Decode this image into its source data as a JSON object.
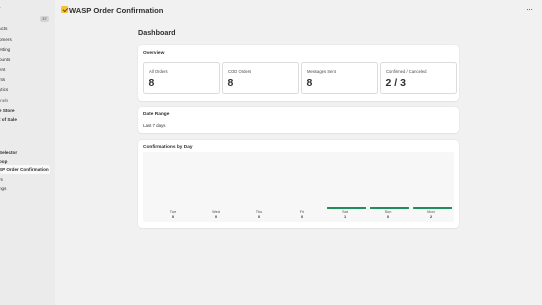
{
  "sidebar": {
    "items": [
      {
        "label": "r",
        "badge": ""
      },
      {
        "label": "",
        "badge": "37"
      },
      {
        "label": "ucts",
        "badge": ""
      },
      {
        "label": "omers",
        "badge": ""
      },
      {
        "label": "etting",
        "badge": ""
      },
      {
        "label": "ounts",
        "badge": ""
      },
      {
        "label": "ent",
        "badge": ""
      },
      {
        "label": "nts",
        "badge": ""
      },
      {
        "label": "ytics",
        "badge": ""
      }
    ],
    "channels_heading": "nnels",
    "channels": [
      {
        "label": "e Store"
      },
      {
        "label": "t of Sale"
      }
    ],
    "apps": [
      {
        "label": "Selector"
      },
      {
        "label": "oop"
      },
      {
        "label": "SP Order Confirmation"
      },
      {
        "label": "rs"
      },
      {
        "label": "ngs"
      }
    ]
  },
  "header": {
    "app_title": "WASP Order Confirmation",
    "menu": "···"
  },
  "page": {
    "title": "Dashboard"
  },
  "overview": {
    "title": "Overview",
    "stats": [
      {
        "label": "All Orders",
        "value": "8"
      },
      {
        "label": "COD Orders",
        "value": "8"
      },
      {
        "label": "Messages Sent",
        "value": "8"
      },
      {
        "label": "Confirmed / Canceled",
        "value": "2 / 3"
      }
    ]
  },
  "date_range": {
    "title": "Date Range",
    "value": "Last 7 days"
  },
  "confirmations": {
    "title": "Confirmations by Day",
    "days": [
      {
        "day": "Tue",
        "count": "0"
      },
      {
        "day": "Wed",
        "count": "0"
      },
      {
        "day": "Thu",
        "count": "0"
      },
      {
        "day": "Fri",
        "count": "0"
      },
      {
        "day": "Sat",
        "count": "1"
      },
      {
        "day": "Sun",
        "count": "0"
      },
      {
        "day": "Mon",
        "count": "2"
      }
    ],
    "bar_color": "#1e8e5a"
  }
}
